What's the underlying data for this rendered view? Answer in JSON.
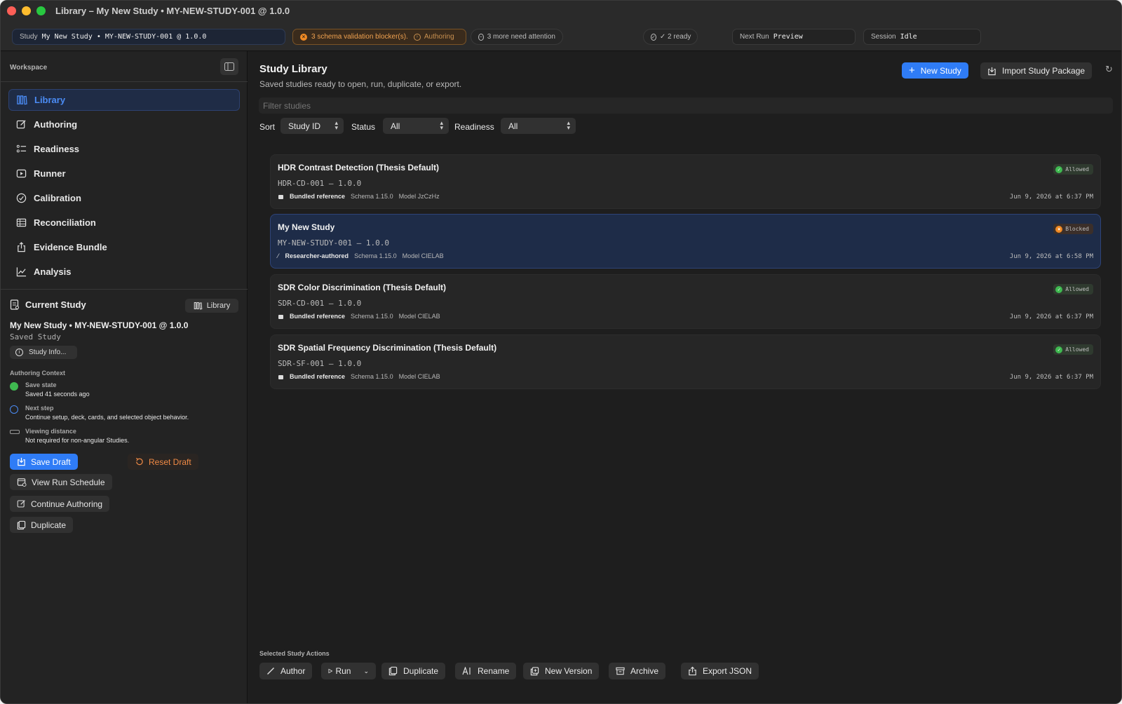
{
  "window": {
    "title": "Library – My New Study • MY-NEW-STUDY-001 @ 1.0.0"
  },
  "toolbar": {
    "study_label": "Study",
    "study_value": "My New Study • MY-NEW-STUDY-001 @ 1.0.0",
    "blocker_text": "3 schema validation blocker(s).",
    "blocker_link": "Authoring",
    "attention_text": "3 more need attention",
    "ready_text": "✓ 2 ready",
    "next_run_label": "Next Run",
    "next_run_value": "Preview",
    "session_label": "Session",
    "session_value": "Idle"
  },
  "sidebar": {
    "workspace_label": "Workspace",
    "nav": [
      {
        "label": "Library",
        "icon": "library-icon",
        "active": true
      },
      {
        "label": "Authoring",
        "icon": "edit-icon",
        "active": false
      },
      {
        "label": "Readiness",
        "icon": "checklist-icon",
        "active": false
      },
      {
        "label": "Runner",
        "icon": "play-icon",
        "active": false
      },
      {
        "label": "Calibration",
        "icon": "gauge-icon",
        "active": false
      },
      {
        "label": "Reconciliation",
        "icon": "table-icon",
        "active": false
      },
      {
        "label": "Evidence Bundle",
        "icon": "share-icon",
        "active": false
      },
      {
        "label": "Analysis",
        "icon": "chart-icon",
        "active": false
      }
    ],
    "current_study": {
      "header": "Current Study",
      "library_button": "Library",
      "title": "My New Study • MY-NEW-STUDY-001 @ 1.0.0",
      "subtitle": "Saved Study",
      "info_button": "Study Info...",
      "context_label": "Authoring Context",
      "context": [
        {
          "title": "Save state",
          "value": "Saved 41 seconds ago",
          "icon": "check-circle-icon",
          "color": "#3fb950"
        },
        {
          "title": "Next step",
          "value": "Continue setup, deck, cards, and selected object behavior.",
          "icon": "arrow-circle-icon",
          "color": "#4b8cf5"
        },
        {
          "title": "Viewing distance",
          "value": "Not required for non-angular Studies.",
          "icon": "ruler-icon",
          "color": "#9a9a9a"
        }
      ],
      "save_draft": "Save Draft",
      "reset_draft": "Reset Draft",
      "view_schedule": "View Run Schedule",
      "continue_authoring": "Continue Authoring",
      "duplicate": "Duplicate"
    }
  },
  "main": {
    "title": "Study Library",
    "subtitle": "Saved studies ready to open, run, duplicate, or export.",
    "new_study": "New Study",
    "import_package": "Import Study Package",
    "filter_placeholder": "Filter studies",
    "sort_label": "Sort",
    "sort_value": "Study ID",
    "status_label": "Status",
    "status_value": "All",
    "readiness_label": "Readiness",
    "readiness_value": "All",
    "studies": [
      {
        "name": "HDR Contrast Detection (Thesis Default)",
        "id": "HDR-CD-001 — 1.0.0",
        "source": "Bundled reference",
        "schema": "Schema 1.15.0",
        "model": "Model JzCzHz",
        "date": "Jun 9, 2026 at 6:37 PM",
        "status": "Allowed",
        "selected": false
      },
      {
        "name": "My New Study",
        "id": "MY-NEW-STUDY-001 — 1.0.0",
        "source": "Researcher-authored",
        "schema": "Schema 1.15.0",
        "model": "Model CIELAB",
        "date": "Jun 9, 2026 at 6:58 PM",
        "status": "Blocked",
        "selected": true
      },
      {
        "name": "SDR Color Discrimination (Thesis Default)",
        "id": "SDR-CD-001 — 1.0.0",
        "source": "Bundled reference",
        "schema": "Schema 1.15.0",
        "model": "Model CIELAB",
        "date": "Jun 9, 2026 at 6:37 PM",
        "status": "Allowed",
        "selected": false
      },
      {
        "name": "SDR Spatial Frequency Discrimination (Thesis Default)",
        "id": "SDR-SF-001 — 1.0.0",
        "source": "Bundled reference",
        "schema": "Schema 1.15.0",
        "model": "Model CIELAB",
        "date": "Jun 9, 2026 at 6:37 PM",
        "status": "Allowed",
        "selected": false
      }
    ],
    "actions_label": "Selected Study Actions",
    "actions": {
      "author": "Author",
      "run": "Run",
      "duplicate": "Duplicate",
      "rename": "Rename",
      "new_version": "New Version",
      "archive": "Archive",
      "export_json": "Export JSON"
    }
  },
  "colors": {
    "accent": "#2f7cf6",
    "allowed": "#3fb950",
    "blocked": "#f08a24"
  }
}
